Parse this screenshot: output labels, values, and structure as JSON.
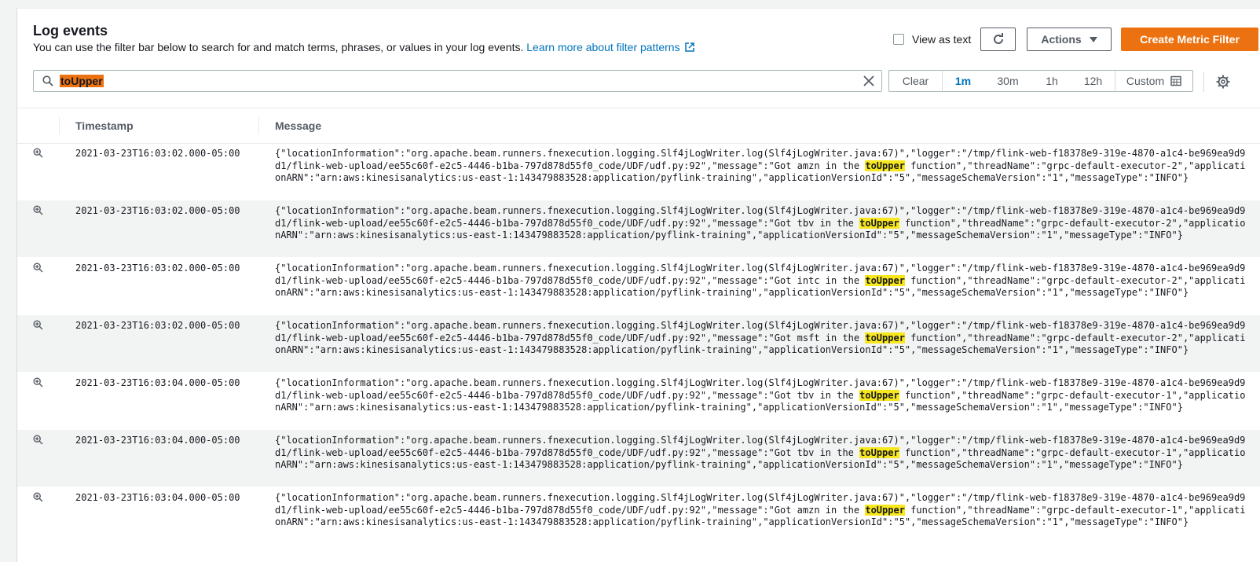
{
  "header": {
    "title": "Log events",
    "description": "You can use the filter bar below to search for and match terms, phrases, or values in your log events.",
    "learn_more_link": "Learn more about filter patterns"
  },
  "toolbar": {
    "view_as_text_label": "View as text",
    "view_as_text_checked": false,
    "actions_label": "Actions",
    "create_metric_filter_label": "Create Metric Filter"
  },
  "search": {
    "value": "toUpper"
  },
  "time_range": {
    "clear_label": "Clear",
    "options": [
      "1m",
      "30m",
      "1h",
      "12h"
    ],
    "selected": "1m",
    "custom_label": "Custom"
  },
  "table": {
    "columns": [
      "Timestamp",
      "Message"
    ],
    "highlight_term": "toUpper",
    "rows": [
      {
        "timestamp": "2021-03-23T16:03:02.000-05:00",
        "message_before": "{\"locationInformation\":\"org.apache.beam.runners.fnexecution.logging.Slf4jLogWriter.log(Slf4jLogWriter.java:67)\",\"logger\":\"/tmp/flink-web-f18378e9-319e-4870-a1c4-be969ea9d9d1/flink-web-upload/ee55c60f-e2c5-4446-b1ba-797d878d55f0_code/UDF/udf.py:92\",\"message\":\"Got amzn in the ",
        "message_after": " function\",\"threadName\":\"grpc-default-executor-2\",\"applicationARN\":\"arn:aws:kinesisanalytics:us-east-1:143479883528:application/pyflink-training\",\"applicationVersionId\":\"5\",\"messageSchemaVersion\":\"1\",\"messageType\":\"INFO\"}"
      },
      {
        "timestamp": "2021-03-23T16:03:02.000-05:00",
        "message_before": "{\"locationInformation\":\"org.apache.beam.runners.fnexecution.logging.Slf4jLogWriter.log(Slf4jLogWriter.java:67)\",\"logger\":\"/tmp/flink-web-f18378e9-319e-4870-a1c4-be969ea9d9d1/flink-web-upload/ee55c60f-e2c5-4446-b1ba-797d878d55f0_code/UDF/udf.py:92\",\"message\":\"Got tbv in the ",
        "message_after": " function\",\"threadName\":\"grpc-default-executor-2\",\"applicationARN\":\"arn:aws:kinesisanalytics:us-east-1:143479883528:application/pyflink-training\",\"applicationVersionId\":\"5\",\"messageSchemaVersion\":\"1\",\"messageType\":\"INFO\"}"
      },
      {
        "timestamp": "2021-03-23T16:03:02.000-05:00",
        "message_before": "{\"locationInformation\":\"org.apache.beam.runners.fnexecution.logging.Slf4jLogWriter.log(Slf4jLogWriter.java:67)\",\"logger\":\"/tmp/flink-web-f18378e9-319e-4870-a1c4-be969ea9d9d1/flink-web-upload/ee55c60f-e2c5-4446-b1ba-797d878d55f0_code/UDF/udf.py:92\",\"message\":\"Got intc in the ",
        "message_after": " function\",\"threadName\":\"grpc-default-executor-2\",\"applicationARN\":\"arn:aws:kinesisanalytics:us-east-1:143479883528:application/pyflink-training\",\"applicationVersionId\":\"5\",\"messageSchemaVersion\":\"1\",\"messageType\":\"INFO\"}"
      },
      {
        "timestamp": "2021-03-23T16:03:02.000-05:00",
        "message_before": "{\"locationInformation\":\"org.apache.beam.runners.fnexecution.logging.Slf4jLogWriter.log(Slf4jLogWriter.java:67)\",\"logger\":\"/tmp/flink-web-f18378e9-319e-4870-a1c4-be969ea9d9d1/flink-web-upload/ee55c60f-e2c5-4446-b1ba-797d878d55f0_code/UDF/udf.py:92\",\"message\":\"Got msft in the ",
        "message_after": " function\",\"threadName\":\"grpc-default-executor-2\",\"applicationARN\":\"arn:aws:kinesisanalytics:us-east-1:143479883528:application/pyflink-training\",\"applicationVersionId\":\"5\",\"messageSchemaVersion\":\"1\",\"messageType\":\"INFO\"}"
      },
      {
        "timestamp": "2021-03-23T16:03:04.000-05:00",
        "message_before": "{\"locationInformation\":\"org.apache.beam.runners.fnexecution.logging.Slf4jLogWriter.log(Slf4jLogWriter.java:67)\",\"logger\":\"/tmp/flink-web-f18378e9-319e-4870-a1c4-be969ea9d9d1/flink-web-upload/ee55c60f-e2c5-4446-b1ba-797d878d55f0_code/UDF/udf.py:92\",\"message\":\"Got tbv in the ",
        "message_after": " function\",\"threadName\":\"grpc-default-executor-1\",\"applicationARN\":\"arn:aws:kinesisanalytics:us-east-1:143479883528:application/pyflink-training\",\"applicationVersionId\":\"5\",\"messageSchemaVersion\":\"1\",\"messageType\":\"INFO\"}"
      },
      {
        "timestamp": "2021-03-23T16:03:04.000-05:00",
        "message_before": "{\"locationInformation\":\"org.apache.beam.runners.fnexecution.logging.Slf4jLogWriter.log(Slf4jLogWriter.java:67)\",\"logger\":\"/tmp/flink-web-f18378e9-319e-4870-a1c4-be969ea9d9d1/flink-web-upload/ee55c60f-e2c5-4446-b1ba-797d878d55f0_code/UDF/udf.py:92\",\"message\":\"Got tbv in the ",
        "message_after": " function\",\"threadName\":\"grpc-default-executor-1\",\"applicationARN\":\"arn:aws:kinesisanalytics:us-east-1:143479883528:application/pyflink-training\",\"applicationVersionId\":\"5\",\"messageSchemaVersion\":\"1\",\"messageType\":\"INFO\"}"
      },
      {
        "timestamp": "2021-03-23T16:03:04.000-05:00",
        "message_before": "{\"locationInformation\":\"org.apache.beam.runners.fnexecution.logging.Slf4jLogWriter.log(Slf4jLogWriter.java:67)\",\"logger\":\"/tmp/flink-web-f18378e9-319e-4870-a1c4-be969ea9d9d1/flink-web-upload/ee55c60f-e2c5-4446-b1ba-797d878d55f0_code/UDF/udf.py:92\",\"message\":\"Got amzn in the ",
        "message_after": " function\",\"threadName\":\"grpc-default-executor-1\",\"applicationARN\":\"arn:aws:kinesisanalytics:us-east-1:143479883528:application/pyflink-training\",\"applicationVersionId\":\"5\",\"messageSchemaVersion\":\"1\",\"messageType\":\"INFO\"}"
      }
    ]
  },
  "icons": {
    "external_link": "external-link-icon",
    "refresh": "refresh-icon",
    "caret": "caret-down-icon",
    "search": "search-icon",
    "clear": "close-icon",
    "calendar": "calendar-icon",
    "settings": "gear-icon",
    "expand_row": "zoom-in-icon"
  },
  "colors": {
    "primary_button": "#ec7211",
    "link": "#0073bb",
    "search_highlight": "#ec7211",
    "term_highlight": "#f8e71c"
  }
}
